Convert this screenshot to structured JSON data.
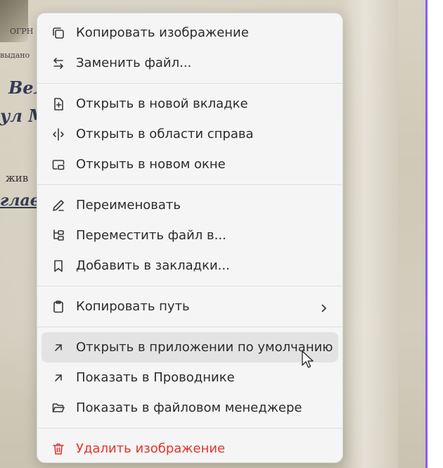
{
  "menu": {
    "items": [
      {
        "label": "Копировать изображение",
        "icon": "copy-icon"
      },
      {
        "label": "Заменить файл...",
        "icon": "swap-icon"
      },
      {
        "label": "Открыть в новой вкладке",
        "icon": "new-tab-icon"
      },
      {
        "label": "Открыть в области справа",
        "icon": "split-right-icon"
      },
      {
        "label": "Открыть в новом окне",
        "icon": "new-window-icon"
      },
      {
        "label": "Переименовать",
        "icon": "pencil-icon"
      },
      {
        "label": "Переместить файл в...",
        "icon": "folder-tree-icon"
      },
      {
        "label": "Добавить в закладки...",
        "icon": "bookmark-icon"
      },
      {
        "label": "Копировать путь",
        "icon": "clipboard-icon"
      },
      {
        "label": "Открыть в приложении по умолчанию",
        "icon": "arrow-up-right-icon"
      },
      {
        "label": "Показать в Проводнике",
        "icon": "arrow-up-right-icon"
      },
      {
        "label": "Показать в файловом менеджере",
        "icon": "folder-open-icon"
      },
      {
        "label": "Удалить изображение",
        "icon": "trash-icon"
      }
    ]
  },
  "background": {
    "fragments": [
      "ОГРН",
      "выдано",
      "Вел",
      "ул М",
      "жив",
      "глав"
    ]
  },
  "colors": {
    "danger": "#e5342a",
    "accent_edge": "#8b5cf6",
    "hover": "#e3e3e3"
  }
}
